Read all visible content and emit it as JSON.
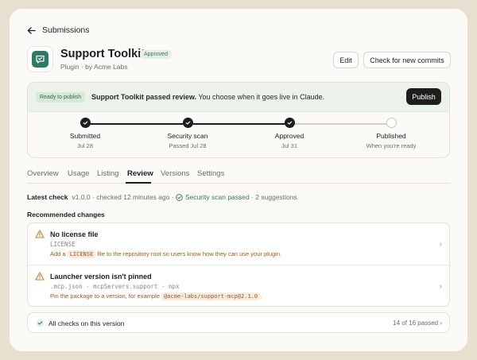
{
  "nav": {
    "back_label": "Submissions"
  },
  "app": {
    "title": "Support Toolkit",
    "badge": "Approved",
    "subtitle": "Plugin · by Acme Labs",
    "edit_label": "Edit",
    "check_label": "Check for new commits",
    "icon_color": "#2f7a62"
  },
  "banner": {
    "pill": "Ready to publish",
    "message_bold": "Support Toolkit passed review.",
    "message_rest": " You choose when it goes live in Claude.",
    "publish_label": "Publish"
  },
  "steps": [
    {
      "label": "Submitted",
      "date": "Jul 28",
      "done": true
    },
    {
      "label": "Security scan",
      "date": "Passed Jul 28",
      "done": true
    },
    {
      "label": "Approved",
      "date": "Jul 31",
      "done": true
    },
    {
      "label": "Published",
      "date": "When you're ready",
      "done": false
    }
  ],
  "tabs": [
    {
      "label": "Overview"
    },
    {
      "label": "Usage"
    },
    {
      "label": "Listing"
    },
    {
      "label": "Review",
      "active": true
    },
    {
      "label": "Versions"
    },
    {
      "label": "Settings"
    }
  ],
  "latest": {
    "label": "Latest check",
    "version": "v1.0.0",
    "checked": "checked 12 minutes ago",
    "scan": "Security scan passed",
    "suggestions": "2 suggestions"
  },
  "recommended": {
    "title": "Recommended changes",
    "issues": [
      {
        "title": "No license file",
        "meta": "LICENSE",
        "desc_pre": "Add a ",
        "desc_code": "LICENSE",
        "desc_post": " file to the repository root so users know how they can use your plugin."
      },
      {
        "title": "Launcher version isn't pinned",
        "meta": ".mcp.json · mcpServers.support · npx",
        "desc_pre": "Pin the package to a version, for example ",
        "desc_code": "@acme-labs/support-mcp@2.1.0",
        "desc_post": "."
      }
    ]
  },
  "checks": {
    "label": "All checks on this version",
    "count": "14 of 16 passed"
  },
  "colors": {
    "accent": "#1f1e1c",
    "success": "#3a7a52",
    "warning": "#c97a2b",
    "background": "#e8dfd0"
  }
}
